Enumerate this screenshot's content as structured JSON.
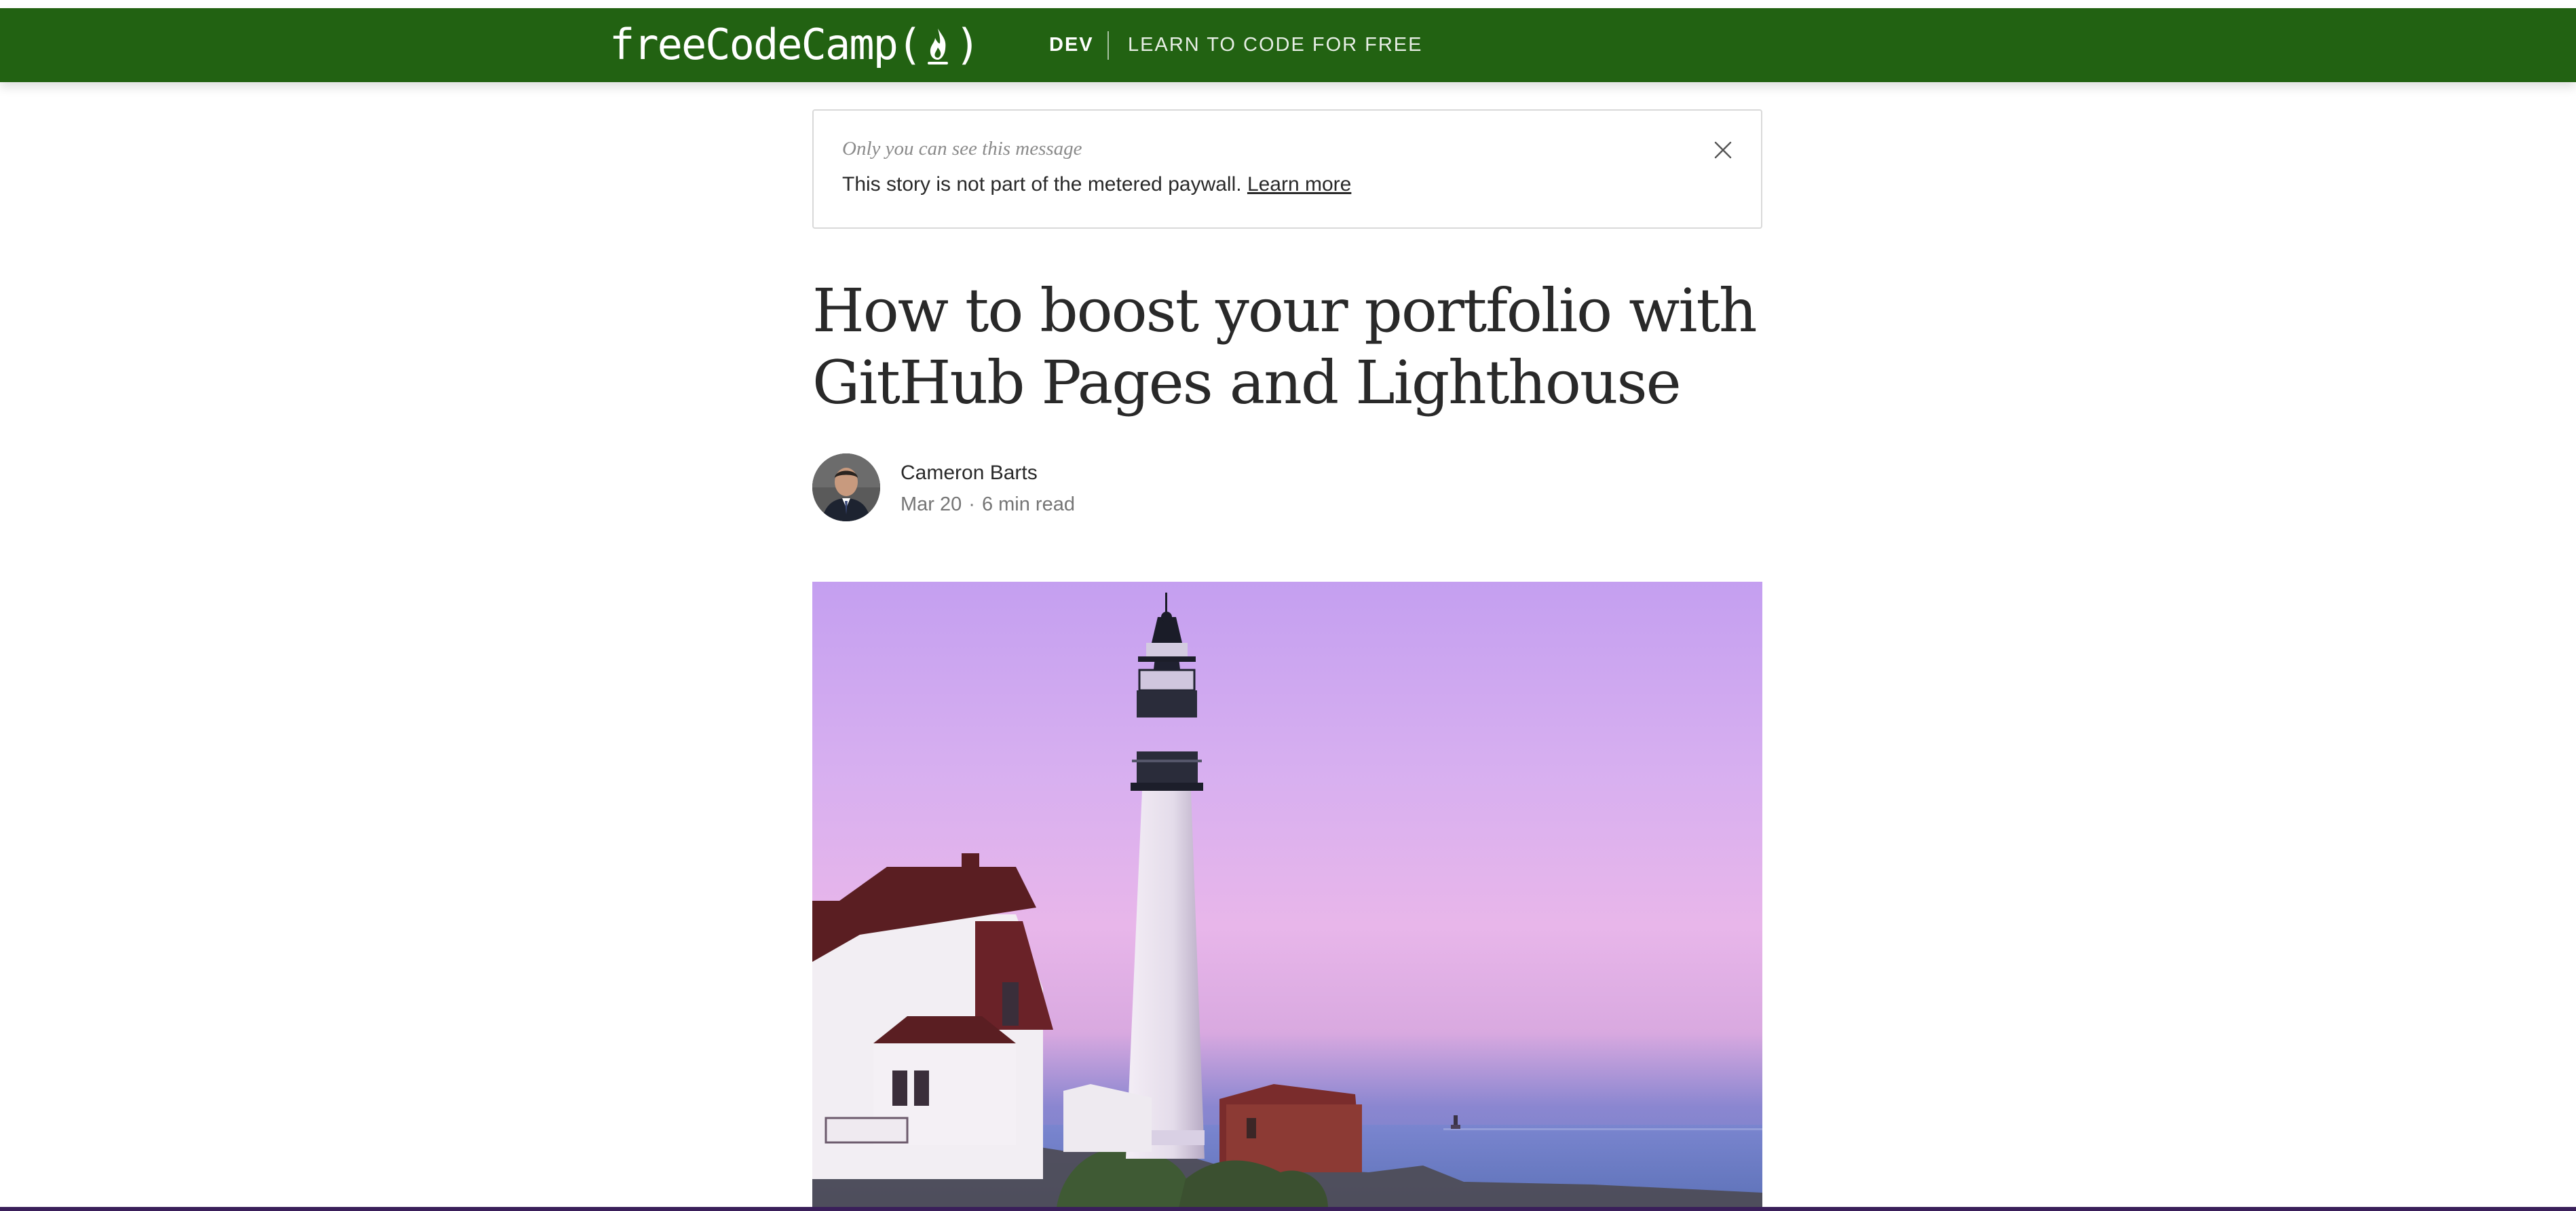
{
  "navbar": {
    "logo_text_left": "freeCodeCamp(",
    "logo_text_right": ")",
    "section": "DEV",
    "tagline": "LEARN TO CODE FOR FREE",
    "brand_color": "#226212"
  },
  "notice": {
    "subtitle": "Only you can see this message",
    "text": "This story is not part of the metered paywall.",
    "link": "Learn more"
  },
  "article": {
    "title": "How to boost your portfolio with GitHub Pages and Lighthouse",
    "author": "Cameron Barts",
    "date": "Mar 20",
    "separator": "·",
    "read_time": "6 min read"
  }
}
